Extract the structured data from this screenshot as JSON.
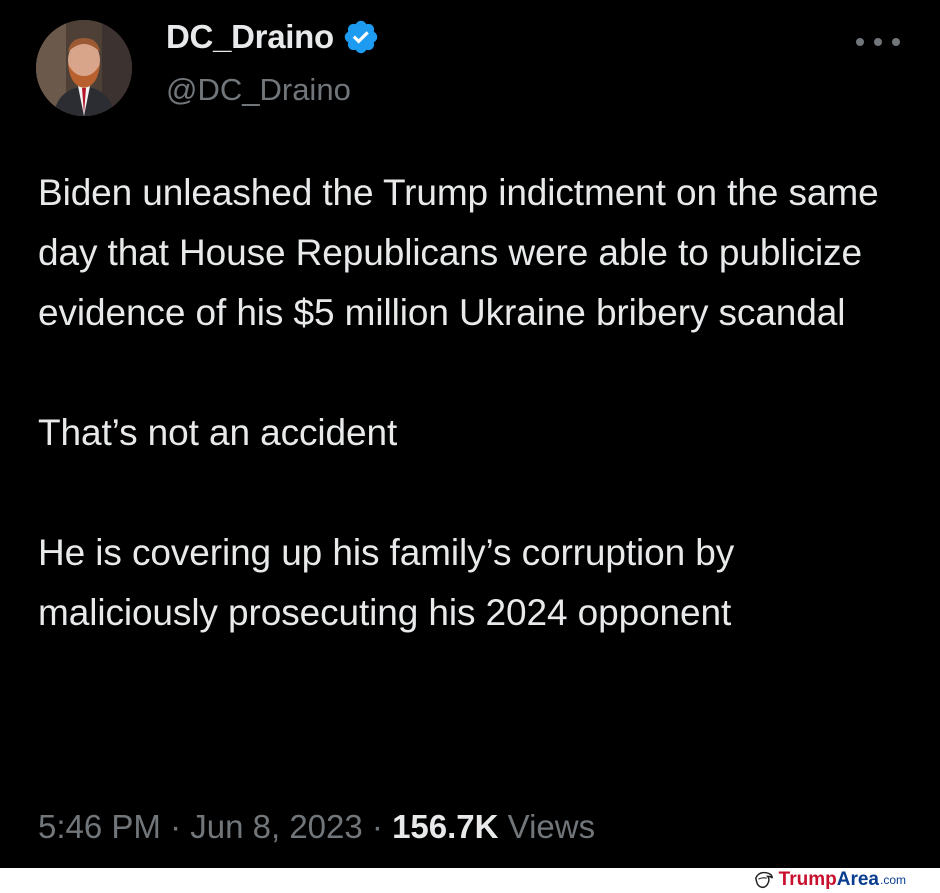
{
  "tweet": {
    "display_name": "DC_Draino",
    "handle": "@DC_Draino",
    "verified_icon": "verified-badge-icon",
    "more_icon": "more-horizontal-icon",
    "paragraphs": [
      "Biden unleashed the Trump indictment on the same day that House Republicans were able to publicize evidence of his $5 million Ukraine bribery scandal",
      "That’s not an accident",
      "He is covering up his family’s corruption by maliciously prosecuting his 2024 opponent"
    ],
    "time": "5:46 PM",
    "date": "Jun 8, 2023",
    "separator": "·",
    "views_count": "156.7K",
    "views_label": "Views"
  },
  "watermark": {
    "brand_red": "Trump",
    "brand_blue": "Area",
    "suffix": ".com"
  },
  "colors": {
    "background": "#000000",
    "text_primary": "#e7e9ea",
    "text_secondary": "#71767b",
    "verified_blue": "#1d9bf0"
  }
}
